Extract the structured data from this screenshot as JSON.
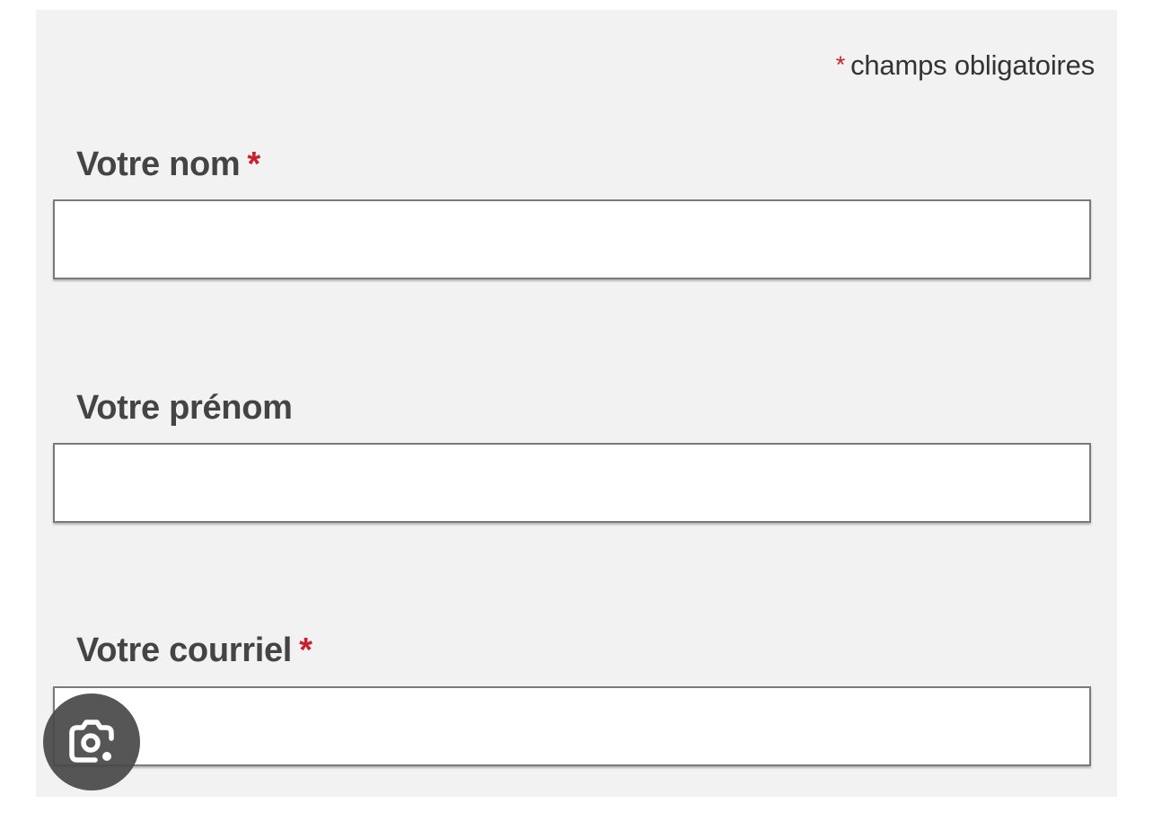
{
  "form": {
    "required_note": {
      "marker": "*",
      "text": "champs obligatoires"
    },
    "fields": {
      "nom": {
        "label": "Votre nom",
        "required_marker": "*",
        "value": ""
      },
      "prenom": {
        "label": "Votre prénom",
        "value": ""
      },
      "courriel": {
        "label": "Votre courriel",
        "required_marker": "*",
        "value": ""
      }
    }
  },
  "overlay": {
    "lens_button_icon": "camera-lens-icon"
  },
  "colors": {
    "panel_background": "#f2f2f2",
    "required_marker": "#cc1f2d",
    "label_text": "#444444",
    "input_border": "#7a7a7a",
    "overlay_button": "#484848"
  }
}
